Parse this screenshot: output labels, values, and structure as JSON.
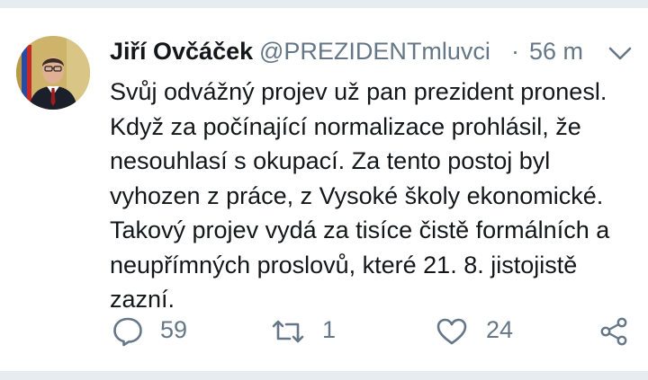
{
  "tweet": {
    "author_name": "Jiří Ovčáček",
    "handle": "@PREZIDENTmluvci",
    "separator": "·",
    "time": "56 m",
    "lines": [
      "Svůj odvážný projev už pan prezident pronesl.",
      "Když za počínající normalizace prohlásil, že",
      "nesouhlasí s okupací. Za tento postoj byl",
      "vyhozen z práce, z Vysoké školy ekonomické.",
      "Takový projev vydá za tisíce čistě formálních a",
      "neupřímných proslovů, které 21. 8. jistojistě",
      "zazní."
    ]
  },
  "actions": {
    "reply_count": "59",
    "retweet_count": "1",
    "like_count": "24"
  },
  "icons": {
    "avatar": "avatar-photo",
    "menu": "chevron-down-icon",
    "reply": "reply-icon",
    "retweet": "retweet-icon",
    "like": "heart-icon",
    "share": "share-icon"
  },
  "colors": {
    "text": "#14171a",
    "secondary": "#657786",
    "divider": "#e6ecf0"
  }
}
